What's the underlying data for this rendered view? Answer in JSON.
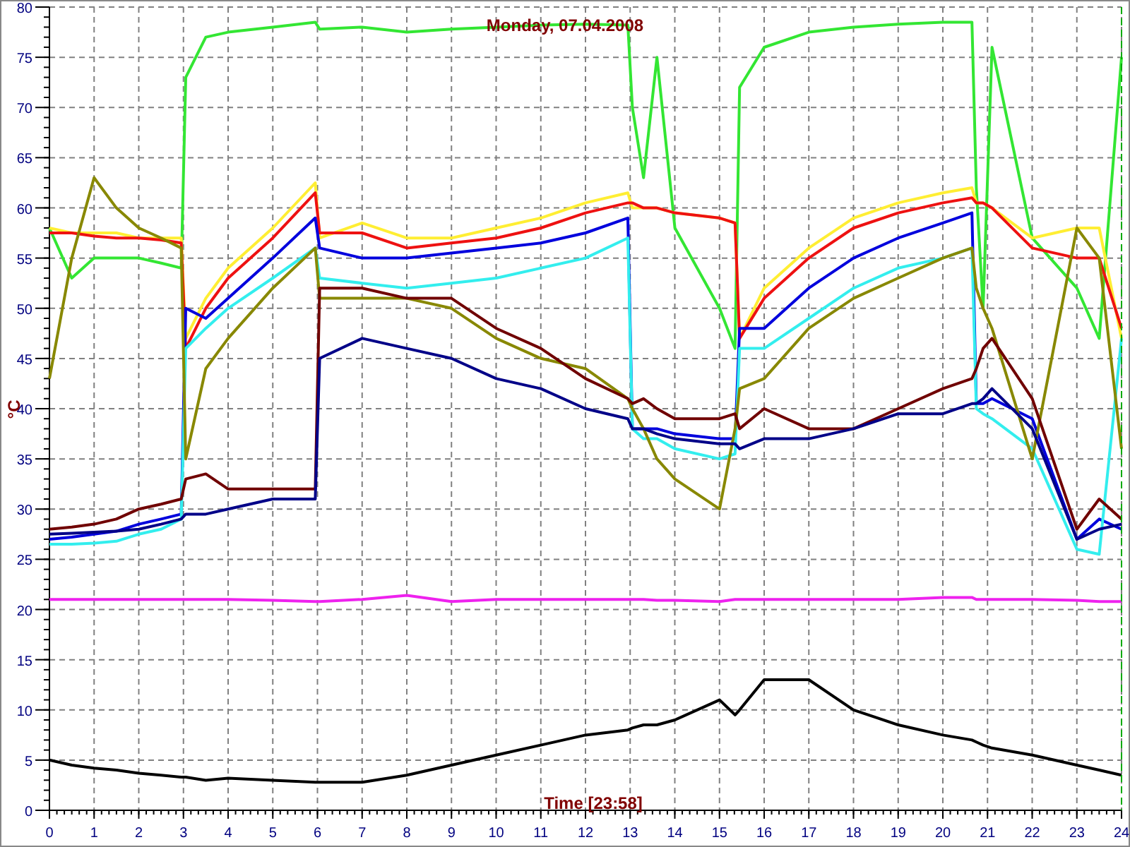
{
  "chart": {
    "chart_data": {
      "type": "line",
      "title": "Monday, 07.04.2008",
      "xlabel": "Time [23:58]",
      "ylabel": "°C",
      "x": [
        0,
        0.5,
        1,
        1.5,
        2,
        2.5,
        2.95,
        3.05,
        3.5,
        4,
        5,
        5.95,
        6.05,
        7,
        8,
        9,
        10,
        11,
        12,
        12.95,
        13.05,
        13.3,
        13.6,
        14,
        15,
        15.35,
        15.45,
        16,
        17,
        18,
        19,
        20,
        20.65,
        20.75,
        20.9,
        21.1,
        22,
        23,
        23.5,
        24
      ],
      "series": [
        {
          "color": "#33e633",
          "values": [
            58,
            53,
            55,
            55,
            55,
            54.5,
            54,
            73,
            77,
            77.5,
            78,
            78.5,
            77.8,
            78,
            77.5,
            77.8,
            78,
            78.2,
            78.3,
            78.2,
            70,
            63,
            75,
            58,
            50,
            46,
            72,
            76,
            77.5,
            78,
            78.3,
            78.5,
            78.5,
            62,
            50,
            76,
            57,
            52,
            47,
            75
          ]
        },
        {
          "color": "#ffee33",
          "values": [
            58,
            57.5,
            57.5,
            57.5,
            57,
            57,
            57,
            47,
            51,
            54,
            58,
            62.5,
            57,
            58.5,
            57,
            57,
            58,
            59,
            60.5,
            61.5,
            60,
            60,
            60,
            59.5,
            59,
            58.5,
            47,
            52,
            56,
            59,
            60.5,
            61.5,
            62,
            60.5,
            60.5,
            60,
            57,
            58,
            58,
            47
          ]
        },
        {
          "color": "#ee1111",
          "values": [
            57.5,
            57.5,
            57.2,
            57,
            57,
            56.8,
            56.5,
            46,
            50,
            53,
            57,
            61.5,
            57.5,
            57.5,
            56,
            56.5,
            57,
            58,
            59.5,
            60.5,
            60.5,
            60,
            60,
            59.5,
            59,
            58.5,
            47,
            51,
            55,
            58,
            59.5,
            60.5,
            61,
            60.5,
            60.5,
            60,
            56,
            55,
            55,
            48
          ]
        },
        {
          "color": "#0000dd",
          "values": [
            27,
            27.2,
            27.5,
            27.8,
            28.5,
            29,
            29.5,
            50,
            49,
            51,
            55,
            59,
            56,
            55,
            55,
            55.5,
            56,
            56.5,
            57.5,
            59,
            38,
            38,
            38,
            37.5,
            37,
            37,
            48,
            48,
            52,
            55,
            57,
            58.5,
            59.5,
            40.5,
            40.5,
            41,
            39,
            27,
            29,
            28
          ]
        },
        {
          "color": "#33eeee",
          "values": [
            26.5,
            26.5,
            26.6,
            26.8,
            27.5,
            28,
            29,
            46,
            48,
            50,
            53,
            56,
            53,
            52.5,
            52,
            52.5,
            53,
            54,
            55,
            57,
            38,
            37,
            37,
            36,
            35,
            35.5,
            46,
            46,
            49,
            52,
            54,
            55,
            56,
            40,
            39.5,
            39,
            36,
            26,
            25.5,
            47
          ]
        },
        {
          "color": "#888800",
          "values": [
            43,
            55,
            63,
            60,
            58,
            57,
            56,
            35,
            44,
            47,
            52,
            56,
            51,
            51,
            51,
            50,
            47,
            45,
            44,
            41,
            40,
            38,
            35,
            33,
            30,
            38,
            42,
            43,
            48,
            51,
            53,
            55,
            56,
            52,
            50,
            48,
            35,
            58,
            55,
            36
          ]
        },
        {
          "color": "#700000",
          "values": [
            28,
            28.2,
            28.5,
            29,
            30,
            30.5,
            31,
            33,
            33.5,
            32,
            32,
            32,
            52,
            52,
            51,
            51,
            48,
            46,
            43,
            41,
            40.5,
            41,
            40,
            39,
            39,
            39.5,
            38,
            40,
            38,
            38,
            40,
            42,
            43,
            44,
            46,
            47,
            41,
            28,
            31,
            29
          ]
        },
        {
          "color": "#000088",
          "values": [
            27.5,
            27.6,
            27.7,
            27.8,
            28,
            28.5,
            29,
            29.5,
            29.5,
            30,
            31,
            31,
            45,
            47,
            46,
            45,
            43,
            42,
            40,
            39,
            38,
            38,
            37.5,
            37,
            36.5,
            36.5,
            36,
            37,
            37,
            38,
            39.5,
            39.5,
            40.5,
            40.5,
            41,
            42,
            38,
            27,
            28,
            28.5
          ]
        },
        {
          "color": "#ee22ee",
          "values": [
            21,
            21,
            21,
            21,
            21,
            21,
            21,
            21,
            21,
            21,
            20.9,
            20.8,
            20.8,
            21,
            21.4,
            20.8,
            21,
            21,
            21,
            21,
            21,
            21,
            20.9,
            20.9,
            20.8,
            21,
            21,
            21,
            21,
            21,
            21,
            21.2,
            21.2,
            21,
            21,
            21,
            21,
            20.9,
            20.8,
            20.8
          ]
        },
        {
          "color": "#000000",
          "values": [
            5,
            4.5,
            4.2,
            4,
            3.7,
            3.5,
            3.3,
            3.3,
            3,
            3.2,
            3,
            2.8,
            2.8,
            2.8,
            3.5,
            4.5,
            5.5,
            6.5,
            7.5,
            8,
            8.2,
            8.5,
            8.5,
            9,
            11,
            9.5,
            10,
            13,
            13,
            10,
            8.5,
            7.5,
            7,
            6.8,
            6.5,
            6.2,
            5.5,
            4.5,
            4,
            3.5
          ]
        }
      ],
      "grid": true,
      "xlim": [
        0,
        24
      ],
      "ylim": [
        0,
        80
      ],
      "xticks": [
        0,
        1,
        2,
        3,
        4,
        5,
        6,
        7,
        8,
        9,
        10,
        11,
        12,
        13,
        14,
        15,
        16,
        17,
        18,
        19,
        20,
        21,
        22,
        23,
        24
      ],
      "yticks": [
        0,
        5,
        10,
        15,
        20,
        25,
        30,
        35,
        40,
        45,
        50,
        55,
        60,
        65,
        70,
        75,
        80
      ]
    }
  }
}
